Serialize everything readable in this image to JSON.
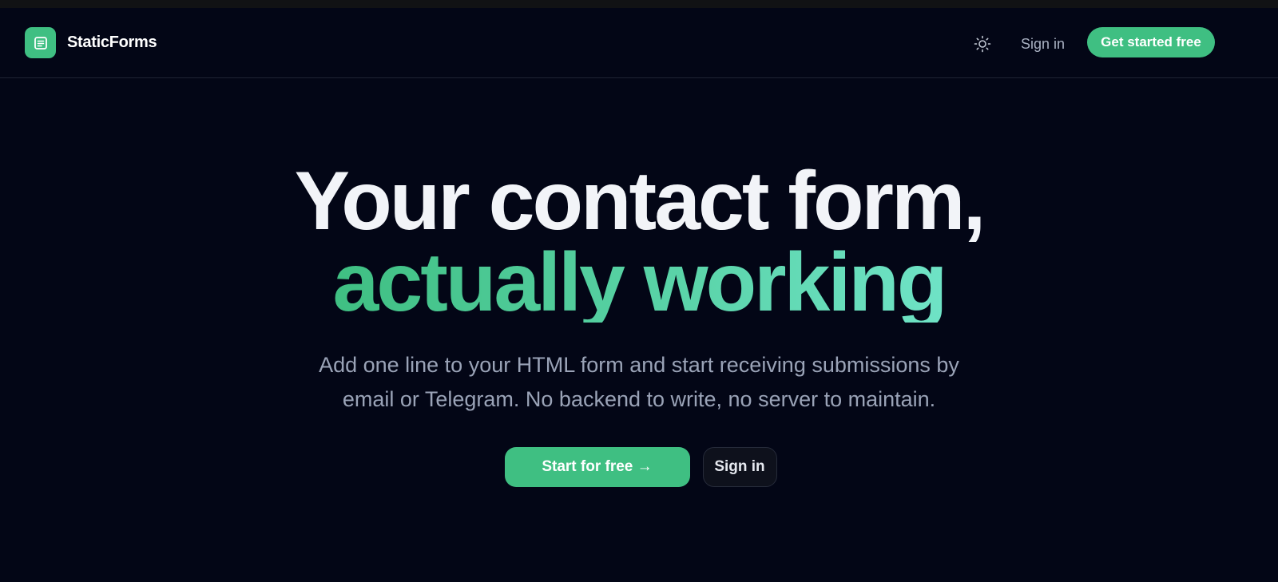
{
  "brand": {
    "name": "StaticForms",
    "logo_icon": "form-document-icon",
    "accent_color": "#3fbf82"
  },
  "nav": {
    "theme_icon": "sun-icon",
    "signin_label": "Sign in",
    "cta_label": "Get started free"
  },
  "hero": {
    "headline": "Your contact form,",
    "headline_accent": "actually working",
    "subtitle_line1": "Add one line to your HTML form and start receiving submissions by",
    "subtitle_line2": "email or Telegram. No backend to write, no server to maintain.",
    "gradient_from": "#3fbf82",
    "gradient_to": "#6fe3c6"
  },
  "actions": {
    "primary_label": "Start for free →",
    "secondary_label": "Sign in"
  }
}
